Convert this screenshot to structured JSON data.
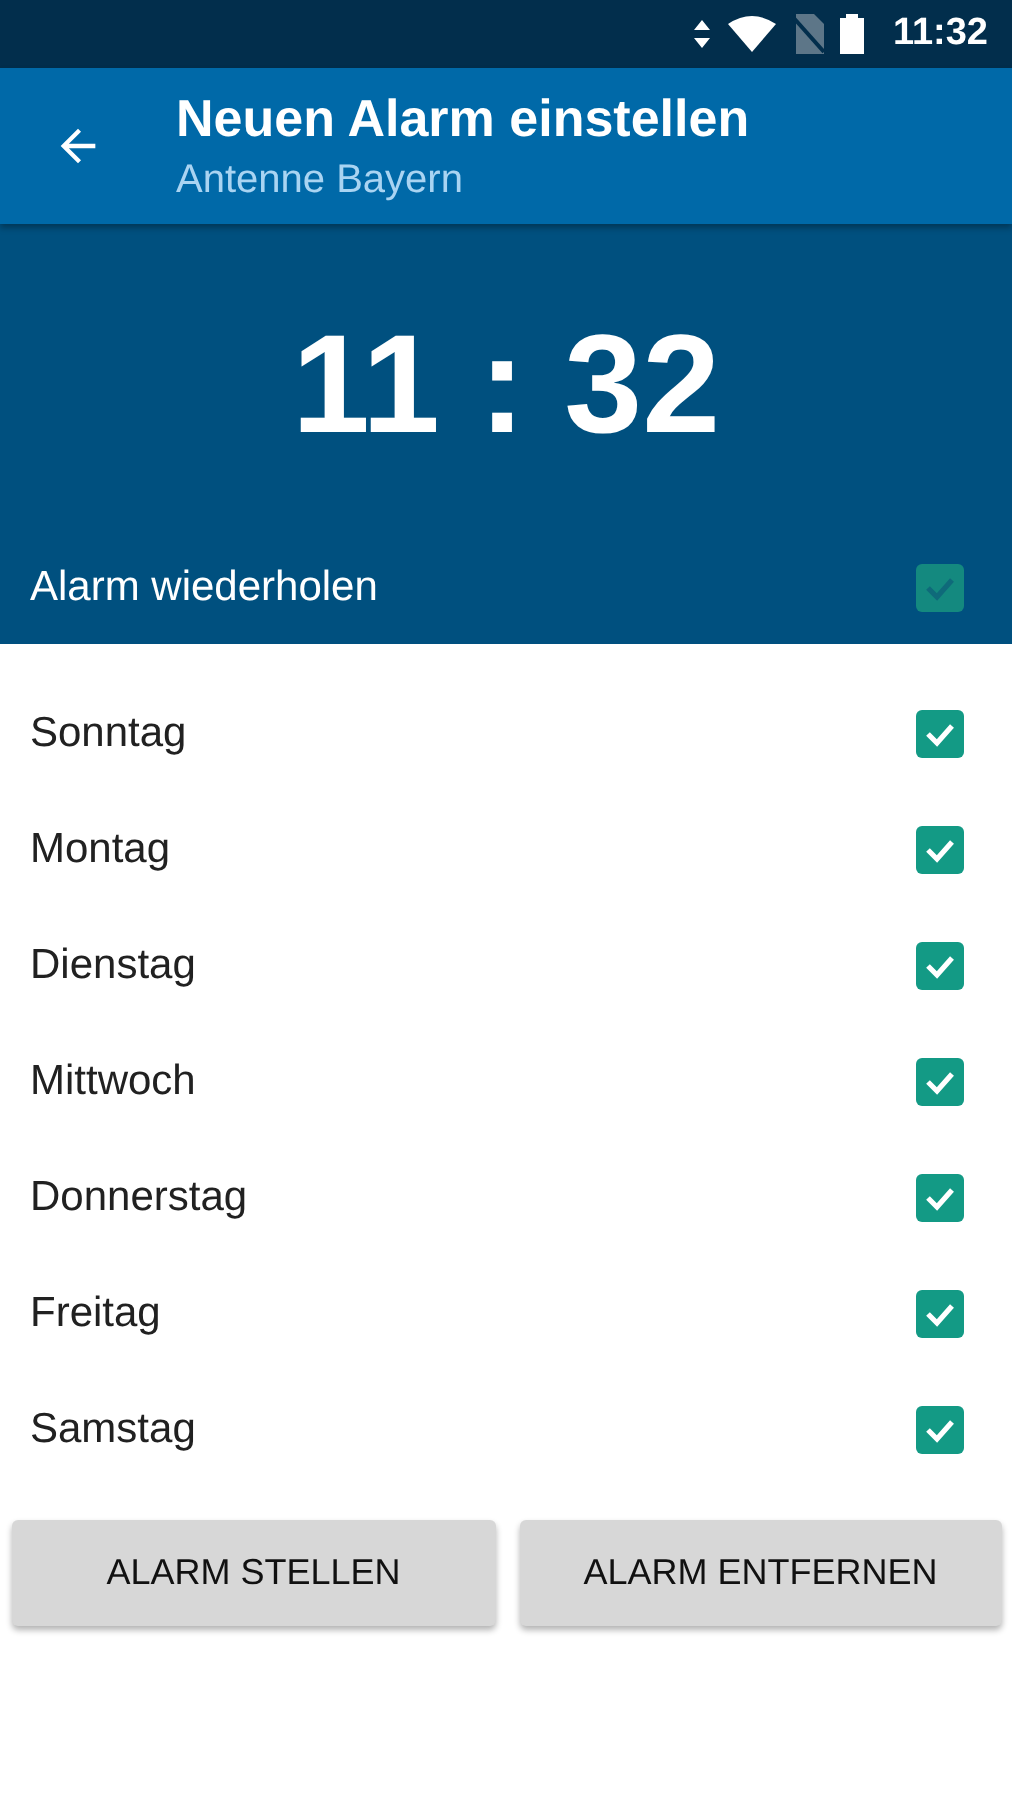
{
  "status_bar": {
    "time": "11:32"
  },
  "app_bar": {
    "title": "Neuen Alarm einstellen",
    "subtitle": "Antenne Bayern"
  },
  "alarm_time": "11 : 32",
  "repeat": {
    "label": "Alarm wiederholen",
    "checked": true
  },
  "days": [
    {
      "label": "Sonntag",
      "checked": true
    },
    {
      "label": "Montag",
      "checked": true
    },
    {
      "label": "Dienstag",
      "checked": true
    },
    {
      "label": "Mittwoch",
      "checked": true
    },
    {
      "label": "Donnerstag",
      "checked": true
    },
    {
      "label": "Freitag",
      "checked": true
    },
    {
      "label": "Samstag",
      "checked": true
    }
  ],
  "buttons": [
    "ALARM STELLEN",
    "ALARM ENTFERNEN"
  ]
}
